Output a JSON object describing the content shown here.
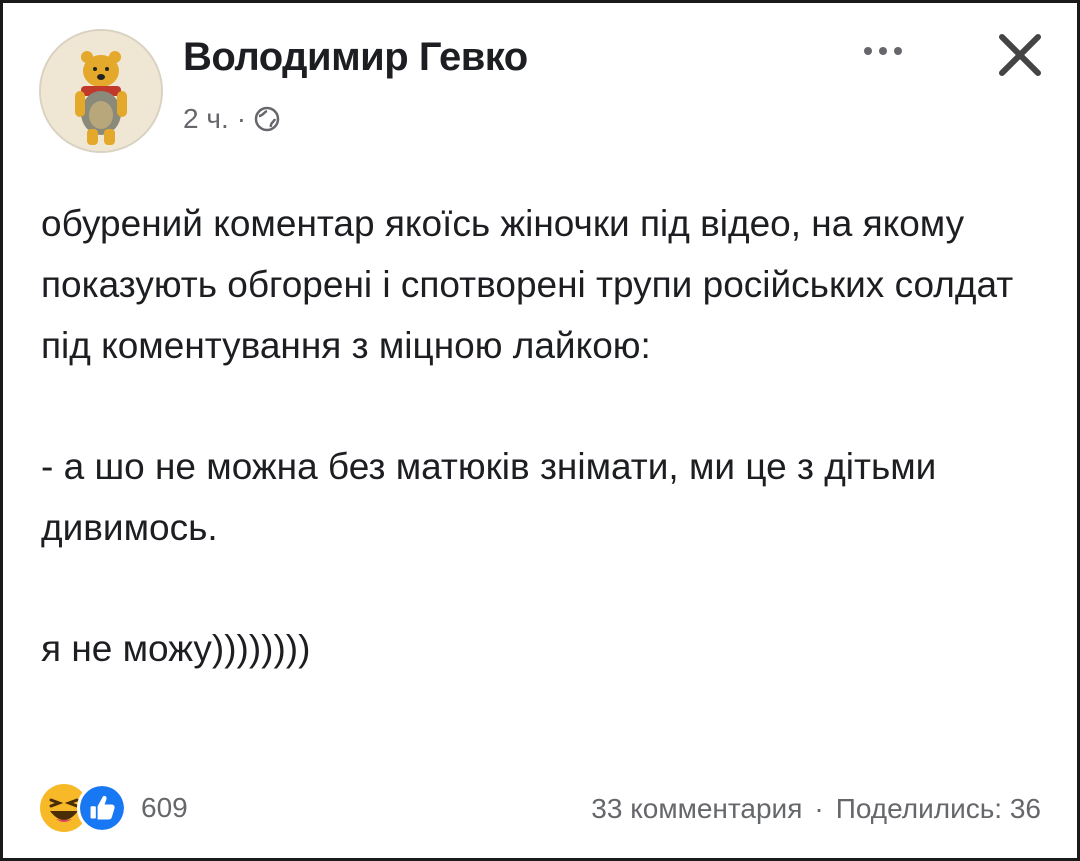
{
  "post": {
    "author_name": "Володимир Гевко",
    "time": "2 ч.",
    "separator": "·",
    "privacy_icon": "globe-icon",
    "more_icon": "more-horizontal-icon",
    "close_icon": "close-icon",
    "paragraphs": [
      "обурений коментар якоїсь жіночки під відео, на якому показують обгорені і спотворені трупи російських солдат під коментування з міцною лайкою:",
      " - а шо не можна без матюків знімати, ми це з дітьми дивимось.",
      "я не можу))))))))"
    ]
  },
  "footer": {
    "reaction_icons": [
      "haha-icon",
      "like-icon"
    ],
    "reaction_count": "609",
    "comments": "33 комментария",
    "separator": "·",
    "shares": "Поделились: 36"
  },
  "colors": {
    "text": "#1c1e21",
    "secondary": "#65676b",
    "like_blue": "#1877f2",
    "haha_yellow": "#f7b928"
  }
}
